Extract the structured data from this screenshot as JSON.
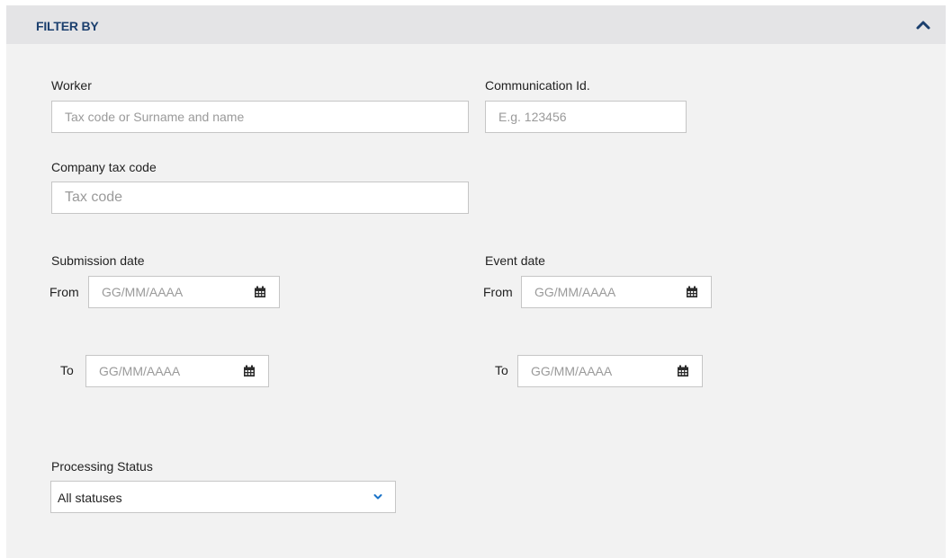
{
  "panel": {
    "title": "FILTER BY"
  },
  "worker": {
    "label": "Worker",
    "placeholder": "Tax code or Surname and name",
    "value": ""
  },
  "communication": {
    "label": "Communication Id.",
    "placeholder": "E.g. 123456",
    "value": ""
  },
  "company": {
    "label": "Company tax code",
    "placeholder": "Tax code",
    "value": ""
  },
  "submission": {
    "label": "Submission date",
    "from_label": "From",
    "to_label": "To",
    "from_placeholder": "GG/MM/AAAA",
    "to_placeholder": "GG/MM/AAAA"
  },
  "event": {
    "label": "Event date",
    "from_label": "From",
    "to_label": "To",
    "from_placeholder": "GG/MM/AAAA",
    "to_placeholder": "GG/MM/AAAA"
  },
  "status": {
    "label": "Processing Status",
    "selected": "All statuses"
  },
  "colors": {
    "header_bg": "#e4e4e6",
    "panel_bg": "#f2f2f2",
    "title": "#1b3f6e",
    "accent": "#1a73c8"
  },
  "icons": {
    "collapse": "chevron-up-icon",
    "calendar": "calendar-icon",
    "dropdown": "chevron-down-icon"
  }
}
